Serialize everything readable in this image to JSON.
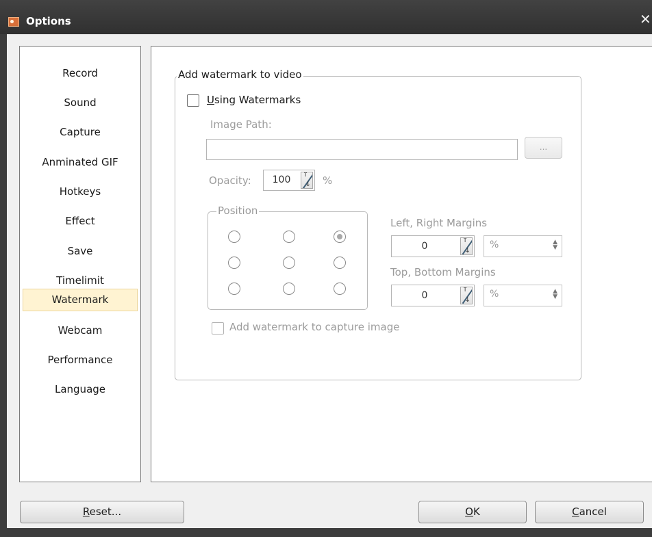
{
  "window": {
    "title": "Options",
    "close_glyph": "✕",
    "icon": "app-icon"
  },
  "nav": {
    "items": [
      {
        "label": "Record"
      },
      {
        "label": "Sound"
      },
      {
        "label": "Capture"
      },
      {
        "label": "Anminated GIF"
      },
      {
        "label": "Hotkeys"
      },
      {
        "label": "Effect"
      },
      {
        "label": "Save"
      },
      {
        "label": "Timelimit"
      },
      {
        "label": "Watermark",
        "selected": true
      },
      {
        "label": "Webcam"
      },
      {
        "label": "Performance"
      },
      {
        "label": "Language"
      }
    ]
  },
  "watermark": {
    "group_title": "Add watermark to video",
    "using": {
      "mnemonic": "U",
      "rest": "sing Watermarks",
      "checked": false
    },
    "image_path_label": "Image Path:",
    "image_path_value": "",
    "browse_label": "...",
    "opacity_label": "Opacity:",
    "opacity_value": "100",
    "opacity_unit": "%",
    "position_title": "Position",
    "position_selected": 2,
    "lr_label": "Left, Right Margins",
    "lr_value": "0",
    "lr_unit": "%",
    "tb_label": "Top, Bottom Margins",
    "tb_value": "0",
    "tb_unit": "%",
    "capture_image_label": "Add watermark to capture image",
    "capture_image_checked": false
  },
  "buttons": {
    "reset": {
      "mnemonic": "R",
      "rest": "eset..."
    },
    "ok": {
      "mnemonic": "O",
      "rest": "K"
    },
    "cancel": {
      "mnemonic": "C",
      "rest": "ancel"
    }
  },
  "colors": {
    "title_bar": "#353535",
    "selected_item": "#fff3d2",
    "frame": "#3c3c3c"
  }
}
